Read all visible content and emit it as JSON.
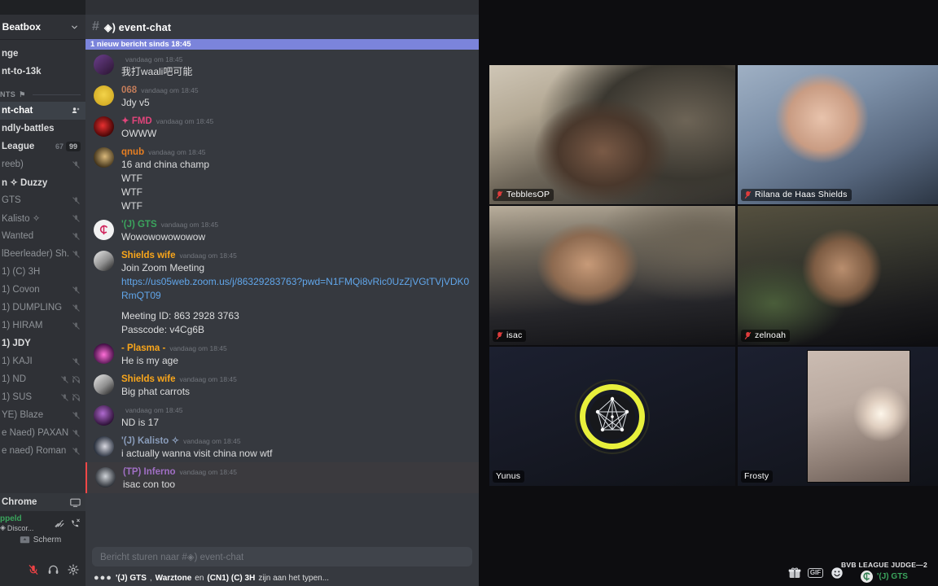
{
  "app": {
    "name": "discord-zoom-screenshare"
  },
  "sidebar": {
    "server_name": "d Beatbox",
    "chevron": "chevron-down-icon",
    "items": [
      {
        "label": "nge",
        "type": "channel",
        "style": "bold"
      },
      {
        "label": "nt-to-13k",
        "type": "channel",
        "style": "bold"
      },
      {
        "label": "NTS",
        "type": "category"
      },
      {
        "label": "nt-chat",
        "type": "channel",
        "style": "active",
        "icon": "add-member-icon"
      },
      {
        "label": "ndly-battles",
        "type": "channel",
        "style": "bold"
      },
      {
        "label": " League",
        "type": "voice",
        "count_left": "67",
        "count_right": "99",
        "style": "bold"
      },
      {
        "label": "reeb)",
        "type": "user",
        "muted": true
      },
      {
        "label": "n ✧ Duzzy",
        "type": "user",
        "style": "bold"
      },
      {
        "label": "GTS",
        "type": "user",
        "muted": true
      },
      {
        "label": "Kalisto ✧",
        "type": "user",
        "muted": true
      },
      {
        "label": "Wanted",
        "type": "user",
        "muted": true
      },
      {
        "label": "lBeerleader) Sh...",
        "type": "user",
        "muted": true
      },
      {
        "label": "1) (C) 3H",
        "type": "user"
      },
      {
        "label": "1) Covon",
        "type": "user",
        "muted": true
      },
      {
        "label": "1) DUMPLING",
        "type": "user",
        "muted": true
      },
      {
        "label": "1) HIRAM",
        "type": "user",
        "muted": true
      },
      {
        "label": "1) JDY",
        "type": "user",
        "style": "bold"
      },
      {
        "label": "1) KAJI",
        "type": "user",
        "muted": true
      },
      {
        "label": "1) ND",
        "type": "user",
        "muted": true,
        "deafened": true
      },
      {
        "label": "1) SUS",
        "type": "user",
        "muted": true,
        "deafened": true
      },
      {
        "label": "YE) Blaze",
        "type": "user",
        "muted": true
      },
      {
        "label": "e Naed) PAXAN",
        "type": "user",
        "muted": true
      },
      {
        "label": "e naed) Roman ...",
        "type": "user",
        "muted": true
      }
    ],
    "streaming_row": {
      "label": "Chrome",
      "icon": "screen-share-icon"
    },
    "voice": {
      "status": "ppeld",
      "server": "Discor...",
      "server_icon": "discord-diamond-icon",
      "disconnect_icon": "call-disconnect-icon",
      "ping_icon": "signal-icon",
      "screen_button": "Scherm",
      "screen_icon": "screen-icon"
    },
    "user_controls": [
      {
        "name": "mic-muted-icon"
      },
      {
        "name": "headphones-icon"
      },
      {
        "name": "gear-icon"
      }
    ]
  },
  "chat": {
    "header": {
      "hash": "#",
      "title": "◈) event-chat"
    },
    "new_messages_divider": "1 nieuw bericht sinds 18:45",
    "messages": [
      {
        "author": "",
        "author_color": "#b13b3b",
        "time": "vandaag om 18:45",
        "lines": [
          "我打waali吧可能"
        ],
        "avatar": "av-purple"
      },
      {
        "author": "068",
        "author_color": "#c27c5a",
        "time": "vandaag om 18:45",
        "lines": [
          "Jdy v5"
        ],
        "avatar": "av-yellow"
      },
      {
        "author": "✦ FMD",
        "author_color": "#e0457b",
        "time": "vandaag om 18:45",
        "lines": [
          "OWWW"
        ],
        "avatar": "av-red"
      },
      {
        "author": "qnub",
        "author_color": "#e67e22",
        "time": "vandaag om 18:45",
        "lines": [
          "16 and china champ",
          "WTF",
          "WTF",
          "WTF"
        ],
        "avatar": "av-owl"
      },
      {
        "author": "'(J) GTS",
        "author_color": "#3ba55d",
        "time": "vandaag om 18:45",
        "lines": [
          "Wowowowowowow"
        ],
        "avatar": "av-gts"
      },
      {
        "author": "Shields wife",
        "author_color": "#faa61a",
        "time": "vandaag om 18:45",
        "lines": [
          "Join Zoom Meeting"
        ],
        "link": "https://us05web.zoom.us/j/86329283763?pwd=N1FMQi8vRic0UzZjVGtTVjVDK0RmQT09",
        "extra": [
          "Meeting ID: 863 2928 3763",
          "Passcode: v4Cg6B"
        ],
        "avatar": "av-stone"
      },
      {
        "author": "- Plasma -",
        "author_color": "#faa61a",
        "time": "vandaag om 18:45",
        "lines": [
          "He is my age"
        ],
        "avatar": "av-magenta"
      },
      {
        "author": "Shields wife",
        "author_color": "#faa61a",
        "time": "vandaag om 18:45",
        "lines": [
          "Big phat carrots"
        ],
        "avatar": "av-stone"
      },
      {
        "author": "",
        "author_color": "#b13b3b",
        "time": "vandaag om 18:45",
        "lines": [
          "ND is 17"
        ],
        "avatar": "av-purple2"
      },
      {
        "author": "'(J) Kalisto ✧",
        "author_color": "#8a9dbb",
        "time": "vandaag om 18:45",
        "lines": [
          "i actually wanna visit china now wtf"
        ],
        "avatar": "av-blue"
      },
      {
        "author": "(TP) Inferno",
        "author_color": "#a06fc4",
        "time": "vandaag om 18:45",
        "lines": [
          "isac con too"
        ],
        "avatar": "av-gray",
        "mentioned": true
      }
    ],
    "composer_placeholder": "Bericht sturen naar #◈)  event-chat",
    "typing_dots": "●●●",
    "typing_names": [
      "'(J) GTS",
      "Warztone",
      "(CN1) (C) 3H"
    ],
    "typing_sep": ", ",
    "typing_conj": " en ",
    "typing_suffix": " zijn aan het typen...",
    "icons": [
      {
        "name": "gift-icon"
      },
      {
        "name": "gif-icon",
        "label": "GIF"
      },
      {
        "name": "emoji-icon"
      }
    ]
  },
  "video_call": {
    "participants": [
      {
        "name": "TebblesOP",
        "muted": true,
        "cam": "cam-a"
      },
      {
        "name": "Rilana de Haas Shields",
        "muted": true,
        "cam": "cam-b"
      },
      {
        "name": "isac",
        "muted": true,
        "cam": "cam-c"
      },
      {
        "name": "zelnoah",
        "muted": true,
        "cam": "cam-d"
      },
      {
        "name": "Yunus",
        "muted": false,
        "cam": "cam-dark",
        "logo": true
      },
      {
        "name": "Frosty",
        "muted": false,
        "cam": "cam-dark",
        "inset": true
      }
    ],
    "overlay": {
      "title": "BVB LEAGUE JUDGE—2",
      "user": "'(J) GTS"
    }
  },
  "colors": {
    "discord_bg": "#36393f",
    "sidebar_bg": "#2f3136",
    "accent_new": "#7b84db",
    "online_green": "#3ba55d",
    "logo_yellow": "#e8f03c",
    "link_blue": "#61a6ea"
  }
}
